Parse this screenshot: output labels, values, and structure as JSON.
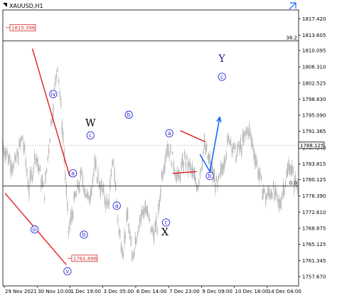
{
  "chart_data": {
    "type": "bar",
    "symbol_timeframe": "XAUUSD,H1",
    "price_axis": {
      "ticks": [
        "1817.420",
        "1813.605",
        "1810.095",
        "1806.310",
        "1802.525",
        "1798.830",
        "1795.090",
        "1791.365",
        "1787.540",
        "1783.815",
        "1780.125",
        "1776.390",
        "1772.610",
        "1768.875",
        "1765.125",
        "1761.345",
        "1757.670"
      ],
      "range": [
        1755.5,
        1819.5
      ]
    },
    "time_axis": {
      "labels": [
        "29 Nov 2021",
        "30 Nov 10:00",
        "1 Dec 19:00",
        "3 Dec 05:00",
        "6 Dec 14:00",
        "7 Dec 23:00",
        "9 Dec 09:00",
        "10 Dec 18:00",
        "14 Dec 04:00"
      ],
      "bar_count": 270
    },
    "price_tags": [
      {
        "text": "1815.396",
        "value": 1815.396,
        "color": "#d32f2f"
      },
      {
        "text": "1761.898",
        "value": 1761.898,
        "color": "#d32f2f"
      },
      {
        "text": "1788.125",
        "value": 1788.125,
        "color": "#000000"
      }
    ],
    "indicator_levels": [
      {
        "text": "38.2",
        "value": 1812.3
      },
      {
        "text": "0.0",
        "value": 1778.7
      }
    ],
    "price_path": [
      [
        0,
        1788
      ],
      [
        10,
        1783
      ],
      [
        18,
        1790
      ],
      [
        24,
        1778
      ],
      [
        30,
        1786
      ],
      [
        38,
        1777
      ],
      [
        44,
        1793
      ],
      [
        50,
        1807
      ],
      [
        55,
        1790
      ],
      [
        60,
        1768
      ],
      [
        66,
        1776
      ],
      [
        72,
        1781
      ],
      [
        78,
        1775
      ],
      [
        84,
        1783
      ],
      [
        90,
        1778
      ],
      [
        96,
        1774
      ],
      [
        101,
        1785
      ],
      [
        106,
        1768
      ],
      [
        110,
        1764
      ],
      [
        114,
        1772
      ],
      [
        118,
        1761.9
      ],
      [
        124,
        1770
      ],
      [
        130,
        1774
      ],
      [
        136,
        1768
      ],
      [
        141,
        1769
      ],
      [
        145,
        1781
      ],
      [
        150,
        1788
      ],
      [
        156,
        1784
      ],
      [
        160,
        1780
      ],
      [
        166,
        1785
      ],
      [
        172,
        1782
      ],
      [
        178,
        1779
      ],
      [
        184,
        1788
      ],
      [
        190,
        1783
      ],
      [
        196,
        1778
      ],
      [
        202,
        1785
      ],
      [
        207,
        1790
      ],
      [
        212,
        1786
      ],
      [
        218,
        1788
      ],
      [
        224,
        1792
      ],
      [
        230,
        1786
      ],
      [
        236,
        1779
      ],
      [
        240,
        1776
      ],
      [
        246,
        1778
      ],
      [
        252,
        1774
      ],
      [
        257,
        1779
      ],
      [
        262,
        1784
      ],
      [
        266,
        1780
      ],
      [
        270,
        1778
      ]
    ],
    "wave_labels": [
      {
        "text": "iv",
        "bar": 46,
        "price": 1800.0,
        "style": "circle-blue"
      },
      {
        "text": "iii",
        "bar": 29,
        "price": 1768.6,
        "style": "circle-blue"
      },
      {
        "text": "v",
        "bar": 59,
        "price": 1758.9,
        "style": "circle-blue"
      },
      {
        "text": "a",
        "bar": 64,
        "price": 1781.6,
        "style": "circle-blue"
      },
      {
        "text": "b",
        "bar": 74,
        "price": 1767.4,
        "style": "circle-blue"
      },
      {
        "text": "c",
        "bar": 80,
        "price": 1790.4,
        "style": "circle-blue"
      },
      {
        "text": "a",
        "bar": 104,
        "price": 1774.1,
        "style": "circle-blue"
      },
      {
        "text": "b",
        "bar": 115,
        "price": 1795.2,
        "style": "circle-blue"
      },
      {
        "text": "a",
        "bar": 152,
        "price": 1790.9,
        "style": "circle-blue"
      },
      {
        "text": "c",
        "bar": 149,
        "price": 1770.2,
        "style": "circle-blue"
      },
      {
        "text": "b",
        "bar": 189,
        "price": 1781.0,
        "style": "circle-blue"
      },
      {
        "text": "c",
        "bar": 200,
        "price": 1804.0,
        "style": "circle-blue"
      },
      {
        "text": "W",
        "bar": 80,
        "price": 1792.5,
        "style": "big"
      },
      {
        "text": "X",
        "bar": 148,
        "price": 1767.2,
        "style": "big"
      },
      {
        "text": "Y",
        "bar": 200,
        "price": 1807.5,
        "style": "big-blue"
      }
    ],
    "red_lines": [
      {
        "from": [
          27,
          1810.5
        ],
        "to": [
          61,
          1781.0
        ]
      },
      {
        "from": [
          2,
          1777.0
        ],
        "to": [
          58,
          1760.4
        ]
      },
      {
        "from": [
          162,
          1791.5
        ],
        "to": [
          185,
          1788.9
        ]
      },
      {
        "from": [
          155,
          1781.6
        ],
        "to": [
          177,
          1782.0
        ]
      }
    ],
    "projection": [
      [
        180,
        1786.0
      ],
      [
        189,
        1782.0
      ],
      [
        198,
        1794.6
      ]
    ],
    "projection_color": "#1565ff",
    "colors": {
      "candles": "#b0b0b0",
      "red": "#e21b1b",
      "wave_circle": "#2b2bd6",
      "grid": "#000000"
    }
  }
}
